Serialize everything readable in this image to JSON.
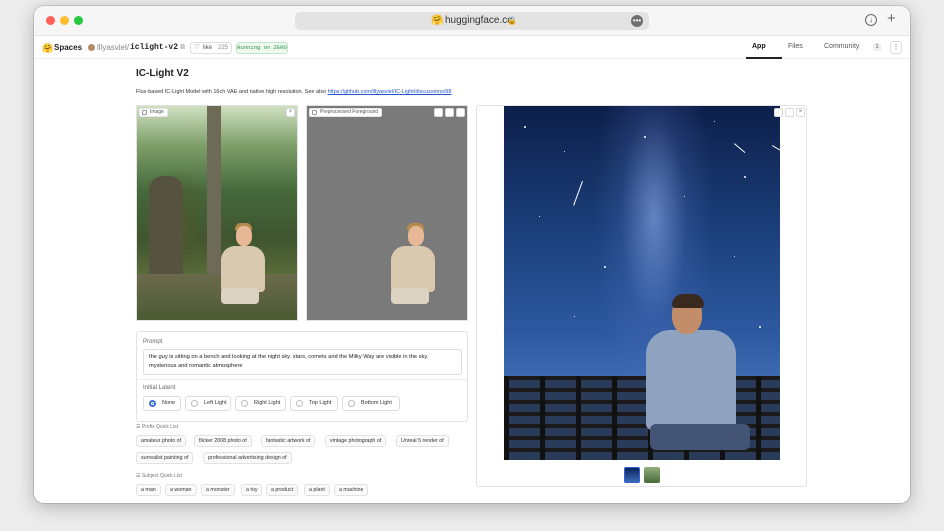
{
  "browser": {
    "url": "huggingface.co",
    "favicon": "🤗",
    "more_glyph": "•••",
    "download_glyph": "↓",
    "new_tab_glyph": "+"
  },
  "header": {
    "logo_glyph": "🤗",
    "spaces_label": "Spaces",
    "owner": "lllyasviel",
    "separator": "/",
    "repo": "iclight-v2",
    "like_label": "like",
    "like_count": "225",
    "running_label": "Running on ZERO",
    "tabs": {
      "app": "App",
      "files": "Files",
      "community": "Community",
      "community_count": "1"
    },
    "menu_glyph": "⋮"
  },
  "app": {
    "title": "IC-Light V2",
    "description": "Flux-based IC-Light Model with 16ch VAE and native high resolution. See also ",
    "link_text": "https://github.com/lllyasviel/IC-Light/discussions/98",
    "image_label": "Image",
    "foreground_label": "Preprocessed Foreground",
    "close_glyph": "×",
    "prompt_label": "Prompt",
    "prompt_value": "the guy is sitting on a bench and looking at the night sky. stars, comets and the Milky Way are visible in the sky. mysterious and romantic atmosphere",
    "latent_label": "Initial Latent",
    "latent_options": [
      "None",
      "Left Light",
      "Right Light",
      "Top Light",
      "Bottom Light"
    ],
    "latent_selected": "None",
    "prefix_label": "Prefix Quick List",
    "prefix_items": [
      "amateur photo of",
      "flicker 2008 photo of",
      "fantastic artwork of",
      "vintage photograph of",
      "Unreal 5 render of",
      "surrealist painting of",
      "professional advertising design of"
    ],
    "subject_label": "Subject Quick List",
    "subject_items": [
      "a man",
      "a woman",
      "a monster",
      "a toy",
      "a product",
      "a plant",
      "a machine"
    ]
  },
  "colors": {
    "accent": "#3a6fd8",
    "running_green": "#2f8f46",
    "link": "#2255cc"
  },
  "icons": [
    "search-icon",
    "lock-icon",
    "download-icon",
    "plus-icon",
    "heart-icon",
    "copy-icon",
    "image-icon",
    "close-icon"
  ]
}
